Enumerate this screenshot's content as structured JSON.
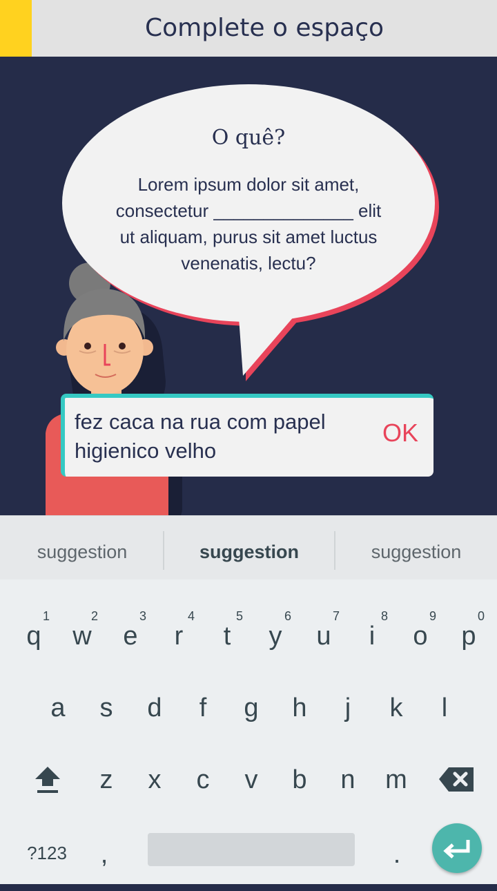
{
  "app": {
    "title": "Complete o espaço"
  },
  "bubble": {
    "title": "O quê?",
    "lines": [
      "Lorem ipsum dolor sit amet,",
      "consectetur ______________ elit",
      "ut aliquam, purus sit amet luctus",
      "venenatis, lectu?"
    ]
  },
  "answer": {
    "lines": [
      "fez caca na rua com papel",
      "higienico velho"
    ],
    "ok_label": "OK"
  },
  "keyboard": {
    "suggestions": [
      "suggestion",
      "suggestion",
      "suggestion"
    ],
    "row1": [
      {
        "key": "q",
        "num": "1"
      },
      {
        "key": "w",
        "num": "2"
      },
      {
        "key": "e",
        "num": "3"
      },
      {
        "key": "r",
        "num": "4"
      },
      {
        "key": "t",
        "num": "5"
      },
      {
        "key": "y",
        "num": "6"
      },
      {
        "key": "u",
        "num": "7"
      },
      {
        "key": "i",
        "num": "8"
      },
      {
        "key": "o",
        "num": "9"
      },
      {
        "key": "p",
        "num": "0"
      }
    ],
    "row2": [
      "a",
      "s",
      "d",
      "f",
      "g",
      "h",
      "j",
      "k",
      "l"
    ],
    "row3": [
      "z",
      "x",
      "c",
      "v",
      "b",
      "n",
      "m"
    ],
    "symbols_label": "?123",
    "comma": ",",
    "period": "."
  },
  "colors": {
    "accent": "#ffd21f",
    "background": "#252c49",
    "bubble_shadow": "#e8445a",
    "input_border": "#35c9c3",
    "ok": "#e8445a",
    "enter": "#4db6ac"
  }
}
